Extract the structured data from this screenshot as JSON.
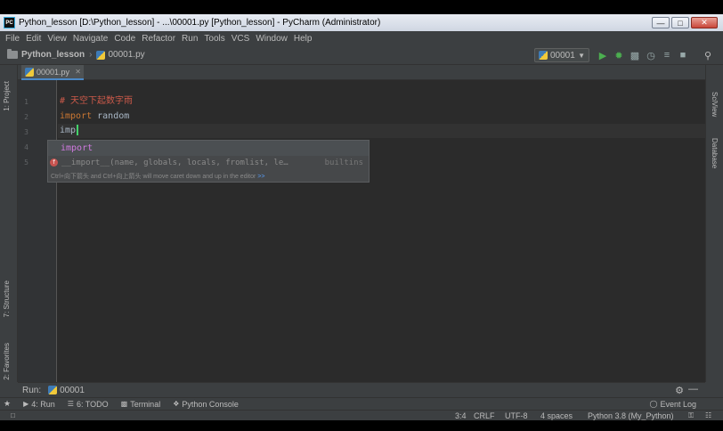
{
  "window": {
    "title": "Python_lesson [D:\\Python_lesson] - ...\\00001.py [Python_lesson] - PyCharm (Administrator)",
    "app_icon": "PC"
  },
  "menu": [
    "File",
    "Edit",
    "View",
    "Navigate",
    "Code",
    "Refactor",
    "Run",
    "Tools",
    "VCS",
    "Window",
    "Help"
  ],
  "navbar": {
    "project": "Python_lesson",
    "file": "00001.py",
    "run_config": "00001"
  },
  "left_tools": {
    "project": "1: Project",
    "structure": "7: Structure",
    "favorites": "2: Favorites"
  },
  "right_tools": {
    "sciview": "SciView",
    "database": "Database"
  },
  "editor": {
    "tab": "00001.py",
    "line_numbers": [
      "1",
      "2",
      "3",
      "4",
      "5"
    ],
    "lines": {
      "l1_comment": "# 天空下起数字雨",
      "l2_kw": "import",
      "l2_rest": " random",
      "l3_typed": "imp"
    }
  },
  "completion": {
    "item1": "import",
    "item2": "__import__(name, globals, locals, fromlist, le…",
    "item2_source": "builtins",
    "hint": "Ctrl+向下箭头 and Ctrl+向上箭头 will move caret down and up in the editor",
    "hint_link": ">>"
  },
  "run_panel": {
    "label": "Run:",
    "config": "00001"
  },
  "bottom_tools": {
    "run": "4: Run",
    "todo": "6: TODO",
    "terminal": "Terminal",
    "console": "Python Console",
    "event_log": "Event Log"
  },
  "status": {
    "position": "3:4",
    "line_sep": "CRLF",
    "encoding": "UTF-8",
    "indent": "4 spaces",
    "interpreter": "Python 3.8 (My_Python)"
  },
  "colors": {
    "keyword": "#cc7832",
    "comment": "#cc5a4a",
    "caret": "#44d36a",
    "run_green": "#4caf50"
  }
}
